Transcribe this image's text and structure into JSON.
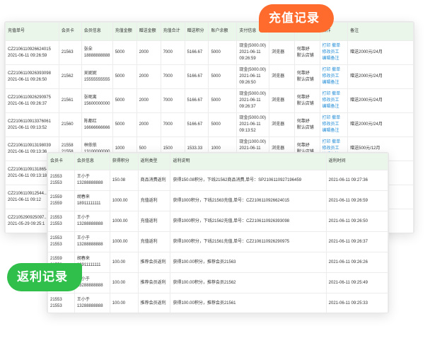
{
  "callouts": {
    "recharge": "充值记录",
    "rebate": "返利记录"
  },
  "recharge": {
    "headers": [
      "充值单号",
      "会员卡",
      "会员信息",
      "充值金额",
      "赠送金额",
      "充值合计",
      "赠送积分",
      "账户余额",
      "支付信息",
      "",
      "员信息",
      "操作",
      "备注"
    ],
    "rows": [
      [
        "CZ2106110926624015\n2021-06-11 09:26:59",
        "21563",
        "张朵\n18888888888",
        "5000",
        "2000",
        "7000",
        "5166.67",
        "5000",
        "现金(5000.00)\n2021-06-11\n09:26:59",
        "浏览器",
        "何靠妤\n默认店铺",
        "打印 撤单\n修改员工\n编辑备注",
        "赠送2000元/24月"
      ],
      [
        "CZ2106110926393098\n2021-06-11 09:26:50",
        "21562",
        "吴妮妮\n15555555555",
        "5000",
        "2000",
        "7000",
        "5166.67",
        "5000",
        "现金(5000.00)\n2021-06-11\n09:26:50",
        "浏览器",
        "何靠妤\n默认店铺",
        "打印 撤单\n修改员工\n编辑备注",
        "赠送2000元/24月"
      ],
      [
        "CZ2106110926290975\n2021-06-11 09:26:37",
        "21561",
        "张呢离\n15600000000",
        "5000",
        "2000",
        "7000",
        "5166.67",
        "5000",
        "现金(5000.00)\n2021-06-11\n09:26:37",
        "浏览器",
        "何靠妤\n默认店铺",
        "打印 撤单\n修改员工\n编辑备注",
        "赠送2000元/24月"
      ],
      [
        "CZ2106110913376061\n2021-06-11 09:13:52",
        "21560",
        "陈都红\n16666666666",
        "5000",
        "2000",
        "7000",
        "5166.67",
        "5000",
        "现金(5000.00)\n2021-06-11\n09:13:52",
        "浏览器",
        "何靠妤\n默认店铺",
        "打印 撤单\n修改员工\n编辑备注",
        "赠送2000元/24月"
      ],
      [
        "CZ2106110913198039\n2021-06-11 09:13:36",
        "21558\n21558",
        "林依依\n13100000000",
        "1000",
        "500",
        "1500",
        "1533.33",
        "1000",
        "现金(1000.00)\n2021-06-11\n09:13:36",
        "浏览器",
        "何靠妤\n默认店铺",
        "打印 撤单\n修改员工\n编辑备注",
        "赠送500元/12月"
      ],
      [
        "CZ2106110913186542\n2021-06-11 09:13:18",
        "21559",
        "",
        "",
        "",
        "",
        "",
        "",
        "",
        "",
        "",
        "",
        ""
      ],
      [
        "CZ2106110912544...\n2021-06-11 09:12",
        "",
        "",
        "",
        "",
        "",
        "",
        "",
        "",
        "",
        "",
        "",
        ""
      ],
      [
        "CZ2105290925097...\n2021-05-29 09:25:1",
        "",
        "",
        "",
        "",
        "",
        "",
        "",
        "",
        "",
        "",
        "",
        ""
      ]
    ]
  },
  "rebate": {
    "headers": [
      "会员卡",
      "会员信息",
      "获得积分",
      "返利类型",
      "返利说明",
      "返利时间"
    ],
    "rows": [
      [
        "21553\n21553",
        "王小于\n13288888888",
        "150.08",
        "商品消费返利",
        "获得150.08积分，下线21562商品消费,单号：SP2106110927196459",
        "2021-06-11 09:27:36"
      ],
      [
        "21559\n21559",
        "胡春来\n18911111111",
        "1000.00",
        "充值返利",
        "获得1000积分，下线21563充值,单号：CZ2106110926624015",
        "2021-06-11 09:26:59"
      ],
      [
        "21553\n21553",
        "王小于\n13288888888",
        "1000.00",
        "充值返利",
        "获得1000积分，下线21562充值,单号：CZ2106110926393098",
        "2021-06-11 09:26:50"
      ],
      [
        "21553\n21553",
        "王小于\n13288888888",
        "1000.00",
        "充值返利",
        "获得1000积分，下线21561充值,单号：CZ2106110926290975",
        "2021-06-11 09:26:37"
      ],
      [
        "21559\n21559",
        "胡春来\n18911111111",
        "100.00",
        "推荐会员返利",
        "获得100.00积分，推荐会员21563",
        "2021-06-11 09:26:26"
      ],
      [
        "21553\n21553",
        "王小于\n13288888888",
        "100.00",
        "推荐会员返利",
        "获得100.00积分，推荐会员21562",
        "2021-06-11 09:25:49"
      ],
      [
        "21553\n21553",
        "王小于\n13288888888",
        "100.00",
        "推荐会员返利",
        "获得100.00积分，推荐会员21561",
        "2021-06-11 09:25:33"
      ]
    ]
  }
}
